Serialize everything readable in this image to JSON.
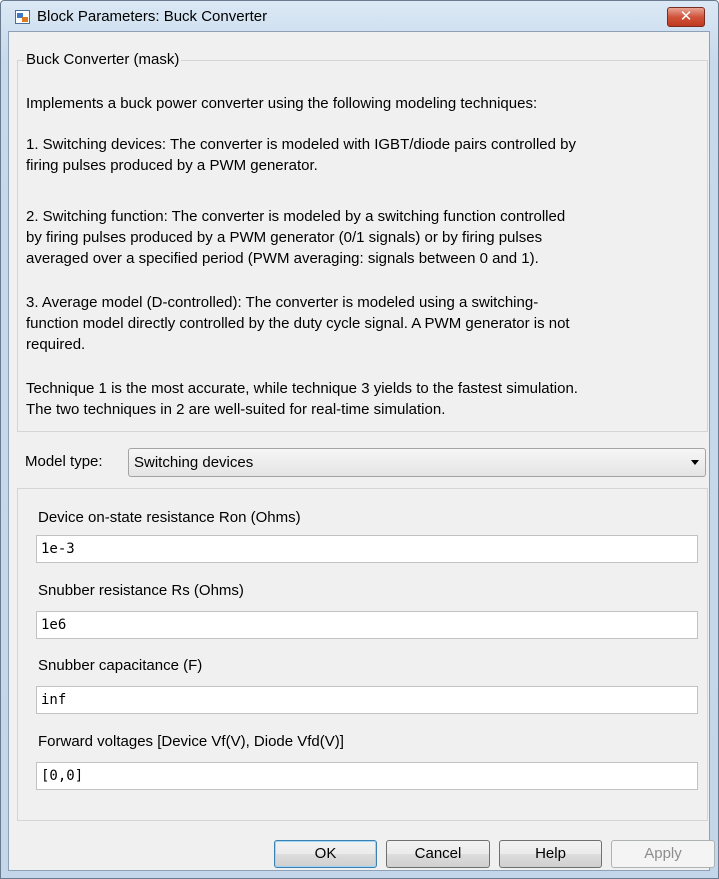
{
  "window": {
    "title": "Block Parameters: Buck Converter",
    "close_symbol": "✕"
  },
  "description": {
    "legend": "Buck Converter (mask)",
    "paragraphs": [
      "Implements a buck power converter using the following modeling techniques:",
      "1. Switching devices: The converter is modeled with IGBT/diode pairs controlled by\nfiring pulses produced by a PWM generator.",
      "2. Switching function: The converter is modeled by a switching function controlled\nby firing pulses produced by a PWM generator (0/1 signals) or by firing pulses\naveraged over a specified period (PWM averaging: signals between 0 and 1).",
      "3. Average model (D-controlled): The converter is modeled using a switching-\nfunction model directly controlled by the duty cycle signal. A PWM generator is not\nrequired.",
      "Technique 1 is the most accurate, while technique 3 yields to the fastest simulation.\nThe two techniques in 2 are well-suited for real-time simulation."
    ]
  },
  "model_type": {
    "label": "Model type:",
    "selected": "Switching devices"
  },
  "parameters": [
    {
      "label": "Device on-state resistance Ron (Ohms)",
      "value": "1e-3"
    },
    {
      "label": "Snubber resistance Rs (Ohms)",
      "value": "1e6"
    },
    {
      "label": "Snubber capacitance (F)",
      "value": "inf"
    },
    {
      "label": "Forward voltages [Device Vf(V), Diode Vfd(V)]",
      "value": "[0,0]"
    }
  ],
  "buttons": {
    "ok": "OK",
    "cancel": "Cancel",
    "help": "Help",
    "apply": "Apply"
  },
  "colors": {
    "close_button": "#c0381f",
    "disabled_text": "#8d8d8d"
  }
}
